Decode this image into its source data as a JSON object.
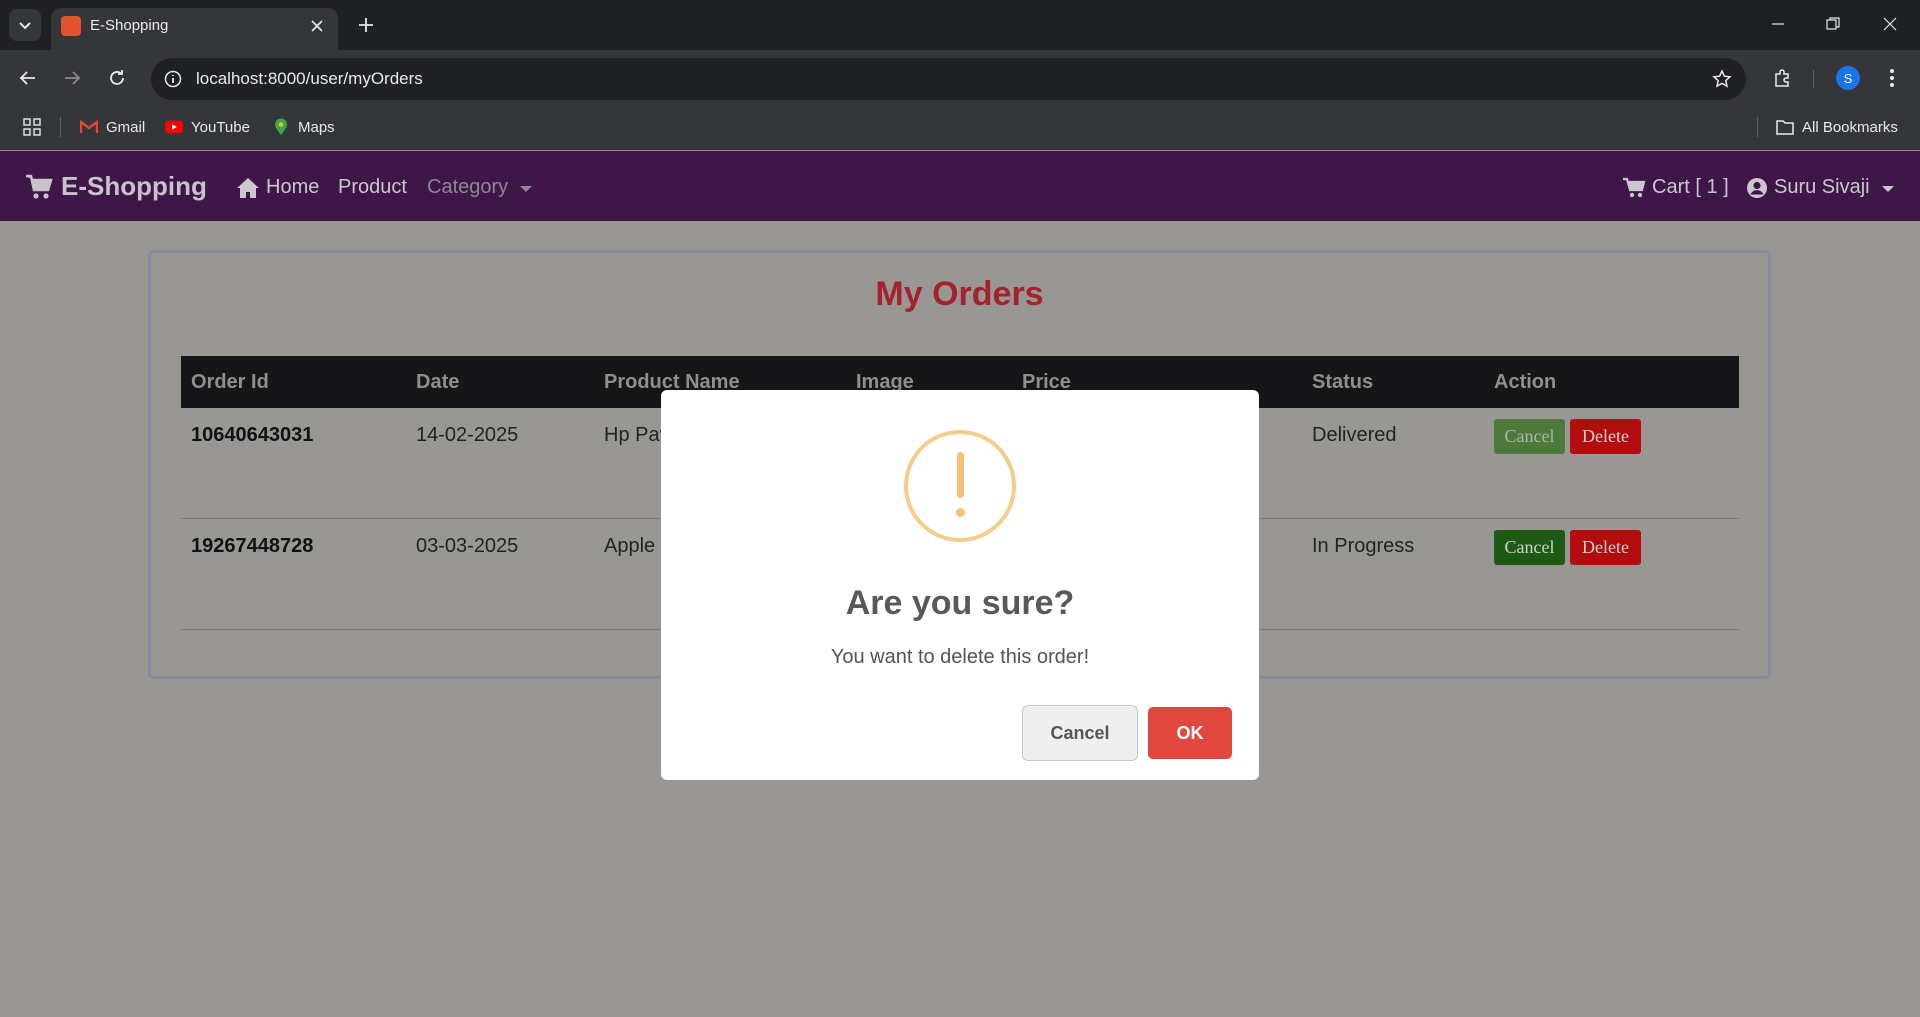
{
  "browser": {
    "tab_title": "E-Shopping",
    "url": "localhost:8000/user/myOrders",
    "profile_initial": "S",
    "bookmarks": [
      {
        "label": "Gmail",
        "icon": "gmail-icon"
      },
      {
        "label": "YouTube",
        "icon": "youtube-icon"
      },
      {
        "label": "Maps",
        "icon": "maps-icon"
      }
    ],
    "all_bookmarks": "All Bookmarks"
  },
  "navbar": {
    "brand": "E-Shopping",
    "home": "Home",
    "product": "Product",
    "category": "Category",
    "cart": "Cart [ 1 ]",
    "user": "Suru Sivaji"
  },
  "orders": {
    "title": "My Orders",
    "columns": [
      "Order Id",
      "Date",
      "Product Name",
      "Image",
      "Price",
      "Status",
      "Action"
    ],
    "rows": [
      {
        "order_id": "10640643031",
        "date": "14-02-2025",
        "product": "Hp Pav",
        "status": "Delivered",
        "cancel": "Cancel",
        "delete": "Delete",
        "cancel_disabled": true
      },
      {
        "order_id": "19267448728",
        "date": "03-03-2025",
        "product": "Apple",
        "status": "In Progress",
        "cancel": "Cancel",
        "delete": "Delete",
        "cancel_disabled": false
      }
    ]
  },
  "modal": {
    "title": "Are you sure?",
    "text": "You want to delete this order!",
    "cancel": "Cancel",
    "ok": "OK"
  },
  "colors": {
    "navbar": "#3e1748",
    "title_red": "#a3222c",
    "ok_button": "#df4740",
    "warning": "#f5c07a"
  }
}
